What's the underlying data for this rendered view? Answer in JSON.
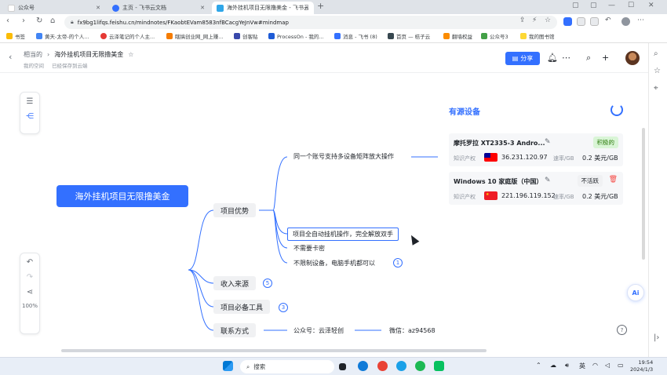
{
  "browser": {
    "tabs": [
      {
        "title": "公众号",
        "active": false
      },
      {
        "title": "主页 - 飞书云文档",
        "active": false
      },
      {
        "title": "海外挂机项目无限撸美金 - 飞书云",
        "active": true
      }
    ],
    "url": "fx9bg1lifqs.feishu.cn/mindnotes/FKaobtEVam8583nfBCacgYeJnVw#mindmap",
    "bookmarks": [
      "书签",
      "黄天-太帝-的个人...",
      "云泽笔记的个人主...",
      "瞎搞创业网_网上赚...",
      "创客贴",
      "ProcessOn - 我的...",
      "消息 - 飞书 (8)",
      "首页 — 桔子云",
      "翻墙权益",
      "公众号3",
      "我的图书馆"
    ]
  },
  "header": {
    "breadcrumb_parent": "相当的",
    "breadcrumb_sep": "›",
    "doc_title": "海外挂机项目无限撸美金",
    "space_label": "我的空间",
    "save_status": "已经保存到云端",
    "share_label": "分享"
  },
  "mindmap": {
    "root": "海外挂机项目无限撸美金",
    "branches": [
      {
        "label": "项目优势",
        "children": [
          "同一个账号支持多设备矩阵放大操作",
          "项目全自动挂机操作，完全解放双手",
          "不需要卡密",
          "不限制设备，电脑手机都可以"
        ],
        "badge": "1"
      },
      {
        "label": "收入来源",
        "badge": "5"
      },
      {
        "label": "项目必备工具",
        "badge": "3"
      },
      {
        "label": "联系方式",
        "children": [
          "公众号：云泽轻创",
          "微信：az94568"
        ]
      }
    ]
  },
  "device_panel": {
    "title": "有源设备",
    "devices": [
      {
        "name": "摩托罗拉 XT2335-3 Andro...",
        "status": "积极的",
        "label": "知识产权",
        "ip": "36.231.120.97",
        "unit": "速率/GB",
        "price": "0.2 美元/GB"
      },
      {
        "name": "Windows 10 家庭版（中国）",
        "status": "不活跃",
        "label": "知识产权",
        "ip": "221.196.119.152",
        "unit": "速率/GB",
        "price": "0.2 美元/GB"
      }
    ]
  },
  "canvas": {
    "zoom": "100%",
    "ai_label": "Ai",
    "help": "?"
  },
  "taskbar": {
    "search": "搜索",
    "lang": "英",
    "time": "19:54",
    "date": "2024/1/3"
  }
}
